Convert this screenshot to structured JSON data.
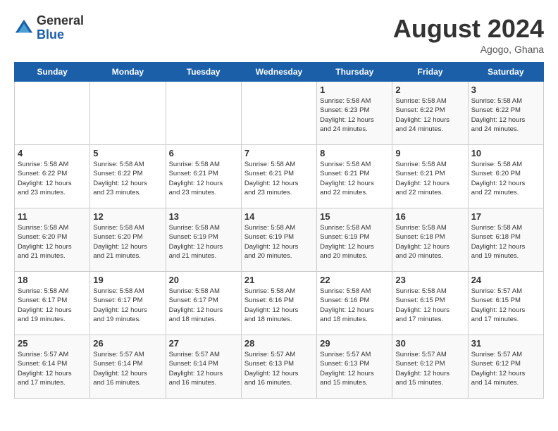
{
  "header": {
    "logo_general": "General",
    "logo_blue": "Blue",
    "month_title": "August 2024",
    "location": "Agogo, Ghana"
  },
  "days_of_week": [
    "Sunday",
    "Monday",
    "Tuesday",
    "Wednesday",
    "Thursday",
    "Friday",
    "Saturday"
  ],
  "weeks": [
    [
      {
        "day": "",
        "info": ""
      },
      {
        "day": "",
        "info": ""
      },
      {
        "day": "",
        "info": ""
      },
      {
        "day": "",
        "info": ""
      },
      {
        "day": "1",
        "info": "Sunrise: 5:58 AM\nSunset: 6:23 PM\nDaylight: 12 hours\nand 24 minutes."
      },
      {
        "day": "2",
        "info": "Sunrise: 5:58 AM\nSunset: 6:22 PM\nDaylight: 12 hours\nand 24 minutes."
      },
      {
        "day": "3",
        "info": "Sunrise: 5:58 AM\nSunset: 6:22 PM\nDaylight: 12 hours\nand 24 minutes."
      }
    ],
    [
      {
        "day": "4",
        "info": "Sunrise: 5:58 AM\nSunset: 6:22 PM\nDaylight: 12 hours\nand 23 minutes."
      },
      {
        "day": "5",
        "info": "Sunrise: 5:58 AM\nSunset: 6:22 PM\nDaylight: 12 hours\nand 23 minutes."
      },
      {
        "day": "6",
        "info": "Sunrise: 5:58 AM\nSunset: 6:21 PM\nDaylight: 12 hours\nand 23 minutes."
      },
      {
        "day": "7",
        "info": "Sunrise: 5:58 AM\nSunset: 6:21 PM\nDaylight: 12 hours\nand 23 minutes."
      },
      {
        "day": "8",
        "info": "Sunrise: 5:58 AM\nSunset: 6:21 PM\nDaylight: 12 hours\nand 22 minutes."
      },
      {
        "day": "9",
        "info": "Sunrise: 5:58 AM\nSunset: 6:21 PM\nDaylight: 12 hours\nand 22 minutes."
      },
      {
        "day": "10",
        "info": "Sunrise: 5:58 AM\nSunset: 6:20 PM\nDaylight: 12 hours\nand 22 minutes."
      }
    ],
    [
      {
        "day": "11",
        "info": "Sunrise: 5:58 AM\nSunset: 6:20 PM\nDaylight: 12 hours\nand 21 minutes."
      },
      {
        "day": "12",
        "info": "Sunrise: 5:58 AM\nSunset: 6:20 PM\nDaylight: 12 hours\nand 21 minutes."
      },
      {
        "day": "13",
        "info": "Sunrise: 5:58 AM\nSunset: 6:19 PM\nDaylight: 12 hours\nand 21 minutes."
      },
      {
        "day": "14",
        "info": "Sunrise: 5:58 AM\nSunset: 6:19 PM\nDaylight: 12 hours\nand 20 minutes."
      },
      {
        "day": "15",
        "info": "Sunrise: 5:58 AM\nSunset: 6:19 PM\nDaylight: 12 hours\nand 20 minutes."
      },
      {
        "day": "16",
        "info": "Sunrise: 5:58 AM\nSunset: 6:18 PM\nDaylight: 12 hours\nand 20 minutes."
      },
      {
        "day": "17",
        "info": "Sunrise: 5:58 AM\nSunset: 6:18 PM\nDaylight: 12 hours\nand 19 minutes."
      }
    ],
    [
      {
        "day": "18",
        "info": "Sunrise: 5:58 AM\nSunset: 6:17 PM\nDaylight: 12 hours\nand 19 minutes."
      },
      {
        "day": "19",
        "info": "Sunrise: 5:58 AM\nSunset: 6:17 PM\nDaylight: 12 hours\nand 19 minutes."
      },
      {
        "day": "20",
        "info": "Sunrise: 5:58 AM\nSunset: 6:17 PM\nDaylight: 12 hours\nand 18 minutes."
      },
      {
        "day": "21",
        "info": "Sunrise: 5:58 AM\nSunset: 6:16 PM\nDaylight: 12 hours\nand 18 minutes."
      },
      {
        "day": "22",
        "info": "Sunrise: 5:58 AM\nSunset: 6:16 PM\nDaylight: 12 hours\nand 18 minutes."
      },
      {
        "day": "23",
        "info": "Sunrise: 5:58 AM\nSunset: 6:15 PM\nDaylight: 12 hours\nand 17 minutes."
      },
      {
        "day": "24",
        "info": "Sunrise: 5:57 AM\nSunset: 6:15 PM\nDaylight: 12 hours\nand 17 minutes."
      }
    ],
    [
      {
        "day": "25",
        "info": "Sunrise: 5:57 AM\nSunset: 6:14 PM\nDaylight: 12 hours\nand 17 minutes."
      },
      {
        "day": "26",
        "info": "Sunrise: 5:57 AM\nSunset: 6:14 PM\nDaylight: 12 hours\nand 16 minutes."
      },
      {
        "day": "27",
        "info": "Sunrise: 5:57 AM\nSunset: 6:14 PM\nDaylight: 12 hours\nand 16 minutes."
      },
      {
        "day": "28",
        "info": "Sunrise: 5:57 AM\nSunset: 6:13 PM\nDaylight: 12 hours\nand 16 minutes."
      },
      {
        "day": "29",
        "info": "Sunrise: 5:57 AM\nSunset: 6:13 PM\nDaylight: 12 hours\nand 15 minutes."
      },
      {
        "day": "30",
        "info": "Sunrise: 5:57 AM\nSunset: 6:12 PM\nDaylight: 12 hours\nand 15 minutes."
      },
      {
        "day": "31",
        "info": "Sunrise: 5:57 AM\nSunset: 6:12 PM\nDaylight: 12 hours\nand 14 minutes."
      }
    ]
  ]
}
